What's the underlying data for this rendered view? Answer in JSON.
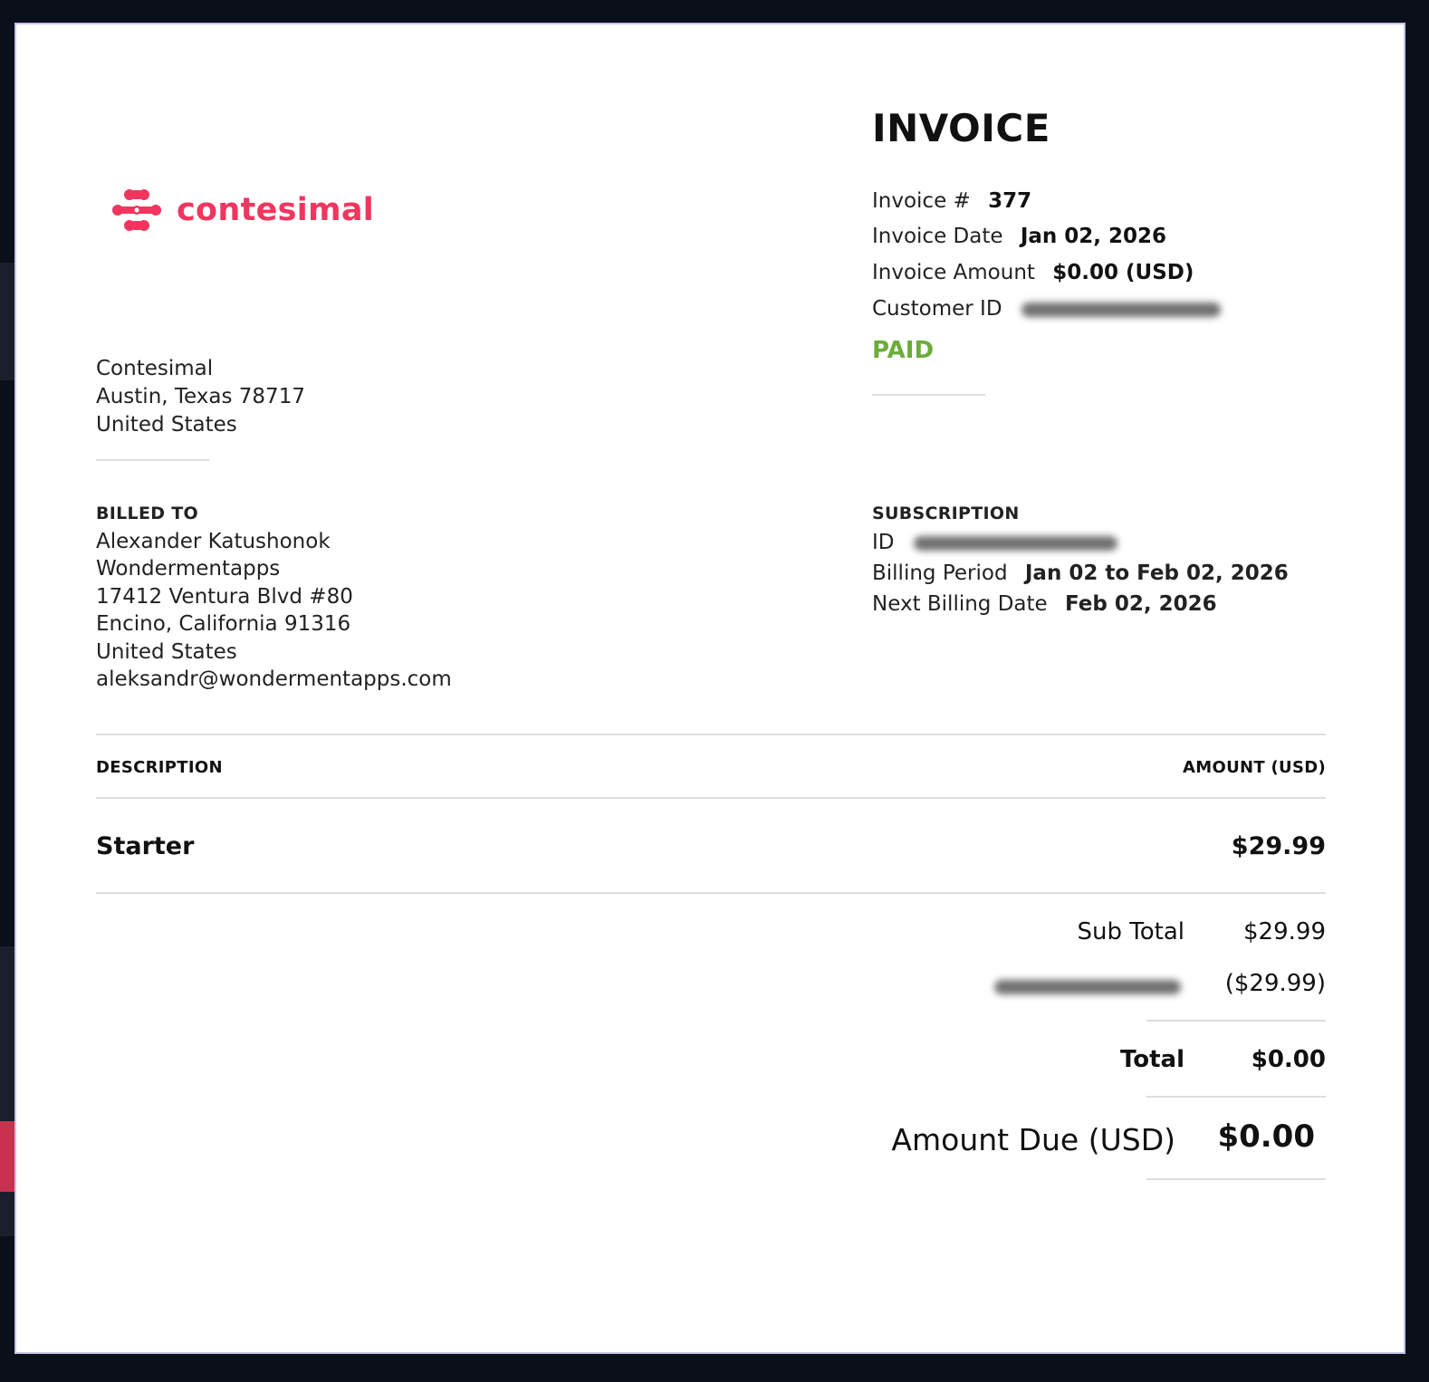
{
  "company": {
    "logo_text": "contesimal",
    "brand_color": "#f0365f",
    "name": "Contesimal",
    "city_line": "Austin, Texas 78717",
    "country": "United States"
  },
  "invoice": {
    "title": "INVOICE",
    "number_label": "Invoice #",
    "number": "377",
    "date_label": "Invoice Date",
    "date": "Jan 02, 2026",
    "amount_label": "Invoice Amount",
    "amount": "$0.00 (USD)",
    "customer_id_label": "Customer ID",
    "status": "PAID",
    "status_color": "#6aad3a"
  },
  "billed_to": {
    "heading": "BILLED TO",
    "lines": [
      "Alexander Katushonok",
      "Wondermentapps",
      "17412 Ventura Blvd #80",
      "Encino, California 91316",
      "United States",
      "aleksandr@wondermentapps.com"
    ]
  },
  "subscription": {
    "heading": "SUBSCRIPTION",
    "id_label": "ID",
    "billing_period_label": "Billing Period",
    "billing_period": "Jan 02 to Feb 02, 2026",
    "next_billing_label": "Next Billing Date",
    "next_billing": "Feb 02, 2026"
  },
  "table": {
    "col_description": "DESCRIPTION",
    "col_amount": "AMOUNT (USD)",
    "items": [
      {
        "description": "Starter",
        "amount": "$29.99"
      }
    ]
  },
  "totals": {
    "subtotal_label": "Sub Total",
    "subtotal": "$29.99",
    "discount": "($29.99)",
    "total_label": "Total",
    "total": "$0.00",
    "amount_due_label": "Amount Due",
    "amount_due_currency": "(USD)",
    "amount_due": "$0.00"
  }
}
